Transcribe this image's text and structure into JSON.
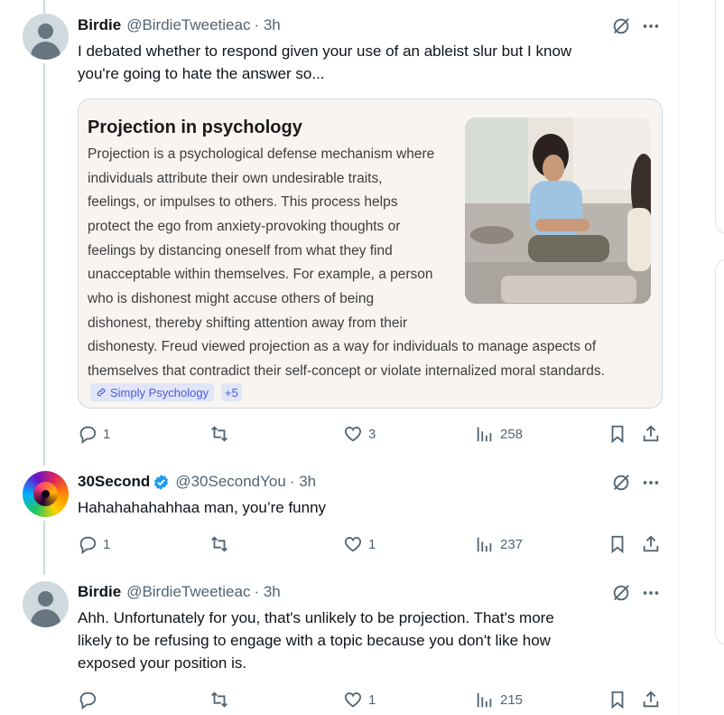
{
  "tweets": [
    {
      "name": "Birdie",
      "handle": "@BirdieTweetieac",
      "time": "· 3h",
      "text": [
        "I debated whether to respond given your use of an ableist slur but I know",
        "you're going to hate the answer so..."
      ],
      "replies": "1",
      "retweets": "",
      "likes": "3",
      "views": "258"
    },
    {
      "name": "30Second",
      "handle": "@30SecondYou",
      "time": "· 3h",
      "verified": true,
      "text": [
        "Hahahahahahhaa man, you’re funny"
      ],
      "replies": "1",
      "retweets": "",
      "likes": "1",
      "views": "237"
    },
    {
      "name": "Birdie",
      "handle": "@BirdieTweetieac",
      "time": "· 3h",
      "text": [
        "Ahh. Unfortunately for you, that's unlikely to be projection. That's more",
        "likely to be refusing to engage with a topic because you don't like how",
        "exposed your position is."
      ],
      "replies": "",
      "retweets": "",
      "likes": "1",
      "views": "215"
    }
  ],
  "card": {
    "title": "Projection in psychology",
    "lines": [
      "Projection is a psychological defense mechanism where",
      "individuals attribute their own undesirable traits,",
      "feelings, or impulses to others. This process helps",
      "protect the ego from anxiety-provoking thoughts or",
      "feelings by distancing oneself from what they find",
      "unacceptable within themselves. For example, a person",
      "who is dishonest might accuse others of being",
      "dishonest, thereby shifting attention away from their",
      "dishonesty. Freud viewed projection as a way for individuals to manage aspects of",
      "themselves that contradict their self-concept or violate internalized moral standards."
    ],
    "source_label": "Simply Psychology",
    "more_sources": "+5"
  },
  "icons": {
    "reply": "reply-icon",
    "retweet": "retweet-icon",
    "like": "heart-icon",
    "views": "views-icon",
    "bookmark": "bookmark-icon",
    "share": "share-icon",
    "grok": "grok-icon",
    "more": "more-icon",
    "verified": "verified-badge-icon",
    "link": "link-icon"
  },
  "colors": {
    "text": "#0f1419",
    "secondary": "#536471",
    "verified": "#1d9bf0",
    "thread_line": "#cfd9de",
    "card_bg": "#f7f4f2",
    "chip_bg": "#e1e5f7",
    "chip_text": "#4a5bd8"
  }
}
